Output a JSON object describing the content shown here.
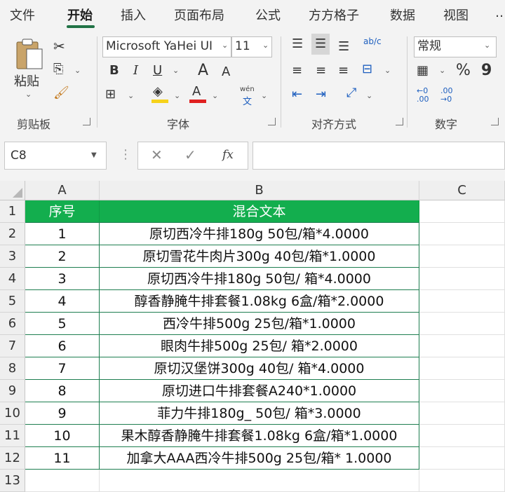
{
  "menu": {
    "tabs": [
      "文件",
      "开始",
      "插入",
      "页面布局",
      "公式",
      "方方格子",
      "数据",
      "视图"
    ],
    "active": "开始"
  },
  "ribbon": {
    "clipboard": {
      "paste": "粘贴",
      "label": "剪贴板"
    },
    "font": {
      "name": "Microsoft YaHei UI",
      "size": "11",
      "label": "字体",
      "bold": "B",
      "italic": "I",
      "underline": "U",
      "grow": "A",
      "shrink": "A",
      "phonetic_top": "wén",
      "phonetic_bottom": "文"
    },
    "alignment": {
      "label": "对齐方式",
      "wrap": "ab/c"
    },
    "number": {
      "format": "常规",
      "label": "数字",
      "percent": "%",
      "comma": "9"
    },
    "colors": {
      "fill": "#f6d21b",
      "font": "#e02020",
      "accent": "#217346"
    }
  },
  "formula_bar": {
    "cell_ref": "C8",
    "fx": "fx",
    "value": ""
  },
  "sheet": {
    "columns": [
      "A",
      "B",
      "C"
    ],
    "row_numbers": [
      "1",
      "2",
      "3",
      "4",
      "5",
      "6",
      "7",
      "8",
      "9",
      "10",
      "11",
      "12",
      "13"
    ],
    "header": [
      "序号",
      "混合文本"
    ],
    "rows": [
      [
        "1",
        "原切西冷牛排180g 50包/箱*4.0000"
      ],
      [
        "2",
        "原切雪花牛肉片300g 40包/箱*1.0000"
      ],
      [
        "3",
        "原切西冷牛排180g 50包/ 箱*4.0000"
      ],
      [
        "4",
        "醇香静腌牛排套餐1.08kg 6盒/箱*2.0000"
      ],
      [
        "5",
        "西冷牛排500g 25包/箱*1.0000"
      ],
      [
        "6",
        "眼肉牛排500g 25包/ 箱*2.0000"
      ],
      [
        "7",
        "原切汉堡饼300g 40包/ 箱*4.0000"
      ],
      [
        "8",
        "原切进口牛排套餐A240*1.0000"
      ],
      [
        "9",
        "菲力牛排180g_ 50包/ 箱*3.0000"
      ],
      [
        "10",
        "果木醇香静腌牛排套餐1.08kg 6盒/箱*1.0000"
      ],
      [
        "11",
        "加拿大AAA西冷牛排500g 25包/箱* 1.0000"
      ]
    ],
    "header_color": "#13ae4e"
  }
}
